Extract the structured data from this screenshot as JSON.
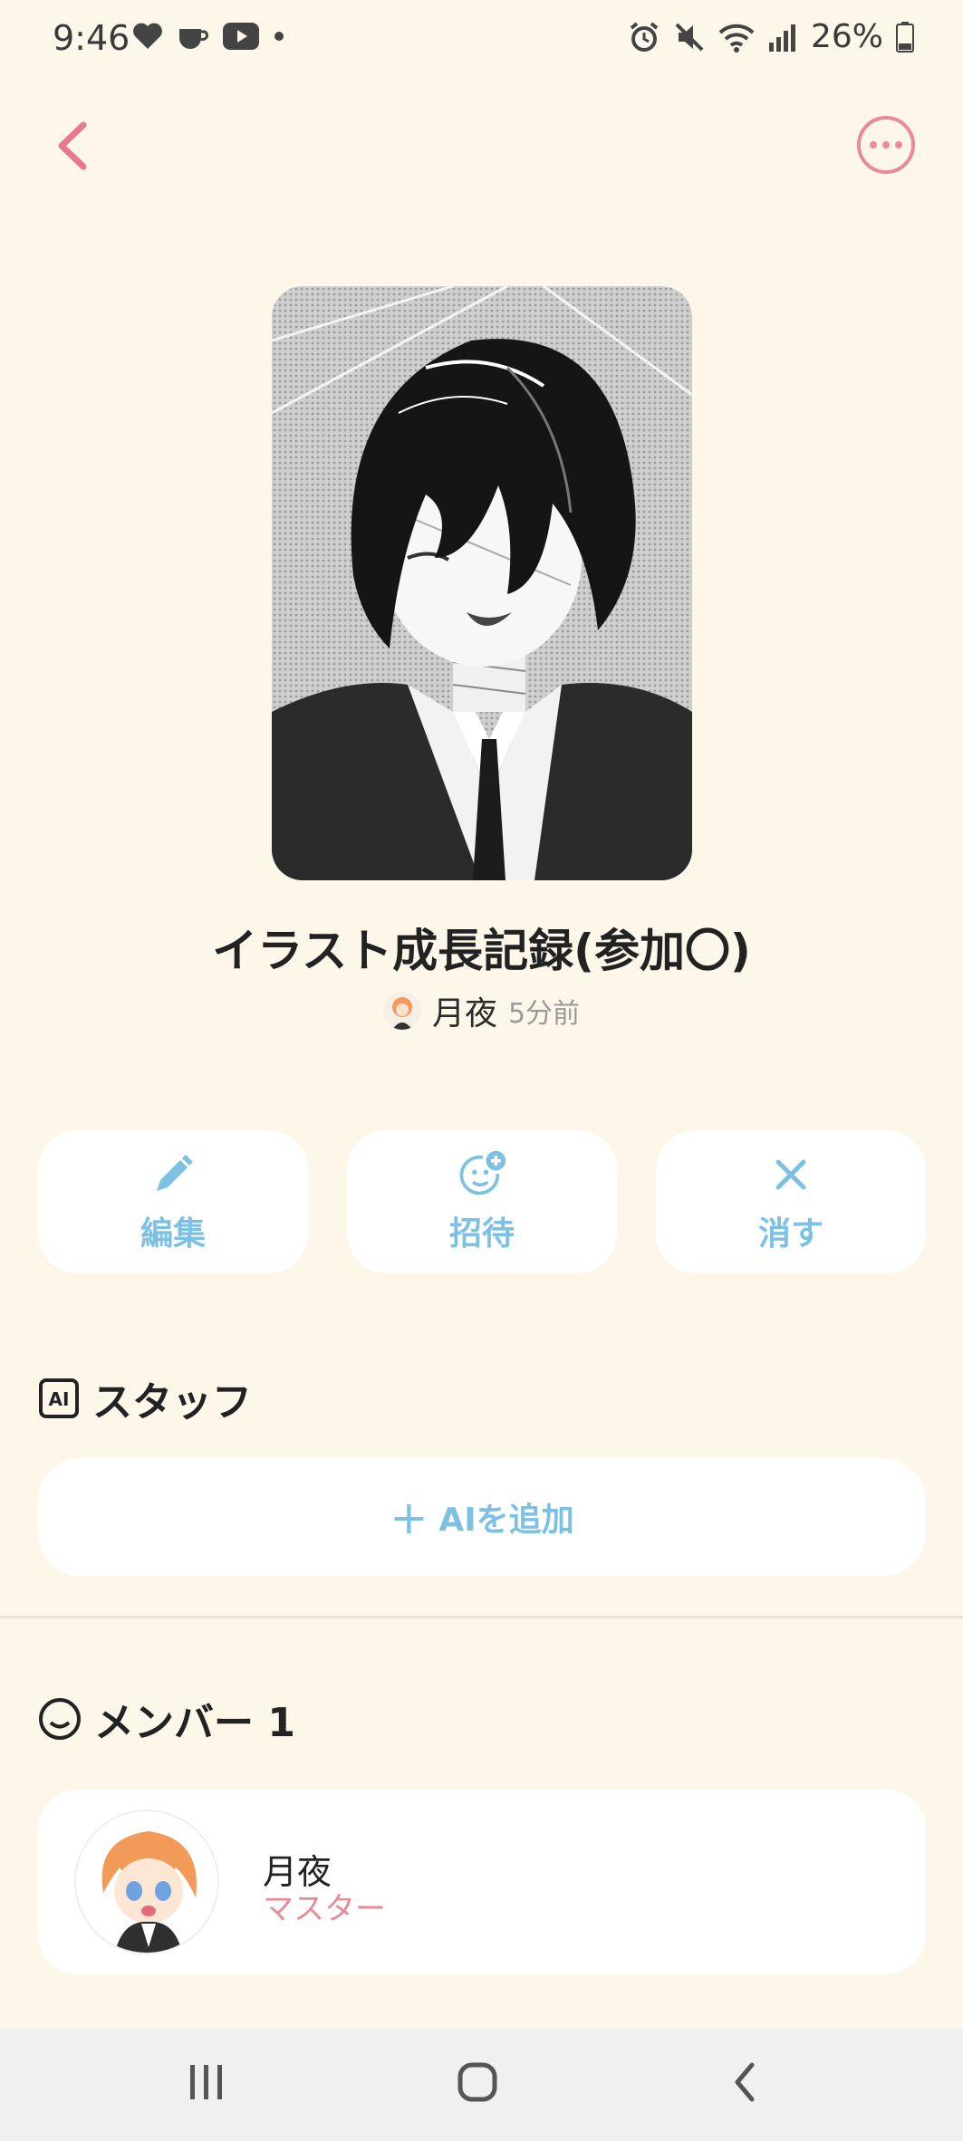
{
  "status_bar": {
    "time": "9:46",
    "left_icons": [
      "heart-icon",
      "cup-icon",
      "youtube-icon",
      "dot-icon"
    ],
    "right_icons": [
      "alarm-icon",
      "mute-icon",
      "wifi-icon",
      "signal-icon",
      "battery-icon"
    ],
    "battery": "26%"
  },
  "header": {
    "back_icon": "chevron-left-icon",
    "more_icon": "more-horizontal-icon"
  },
  "book": {
    "title": "イラスト成長記録(参加〇)",
    "author": "月夜",
    "updated": "5分前"
  },
  "actions": [
    {
      "label": "編集",
      "icon": "pencil-icon"
    },
    {
      "label": "招待",
      "icon": "invite-icon"
    },
    {
      "label": "消す",
      "icon": "close-icon"
    }
  ],
  "staff": {
    "heading": "スタッフ",
    "add_label": "AIを追加"
  },
  "members": {
    "heading": "メンバー 1",
    "items": [
      {
        "name": "月夜",
        "role": "マスター"
      }
    ]
  },
  "colors": {
    "background": "#fdf7ea",
    "accent_blue": "#7cc1e4",
    "accent_pink": "#e88a98"
  }
}
